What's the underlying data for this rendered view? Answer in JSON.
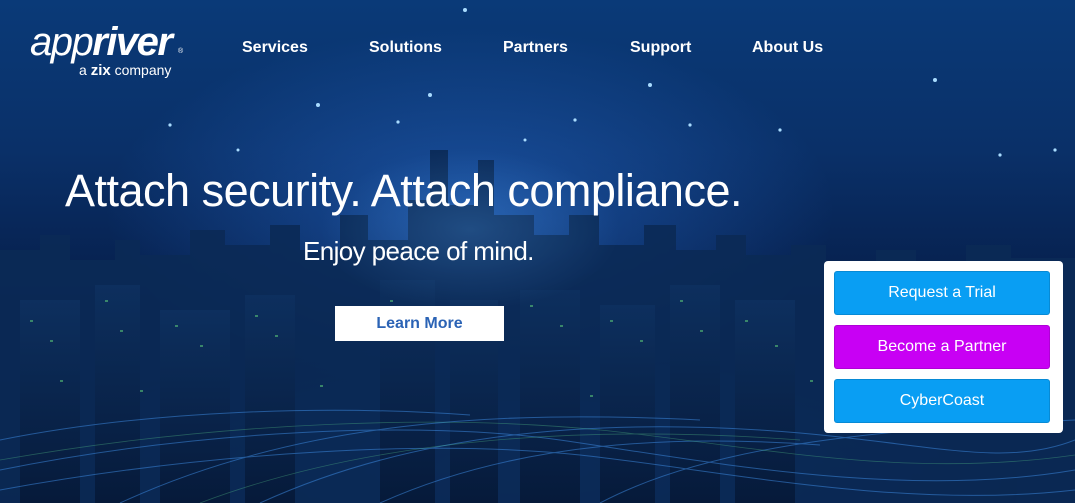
{
  "logo": {
    "word_light": "app",
    "word_bold": "river",
    "registered": "®",
    "tag_prefix": "a ",
    "tag_brand": "zix",
    "tag_suffix": " company"
  },
  "nav": {
    "items": [
      {
        "label": "Services"
      },
      {
        "label": "Solutions"
      },
      {
        "label": "Partners"
      },
      {
        "label": "Support"
      },
      {
        "label": "About Us"
      }
    ]
  },
  "hero": {
    "headline": "Attach security. Attach compliance.",
    "subheadline": "Enjoy peace of mind.",
    "cta_label": "Learn More"
  },
  "cta_panel": {
    "buttons": [
      {
        "label": "Request a Trial",
        "color": "#099ef3"
      },
      {
        "label": "Become a Partner",
        "color": "#c800f4"
      },
      {
        "label": "CyberCoast",
        "color": "#099ef3"
      }
    ]
  },
  "colors": {
    "learn_more_text": "#2b63b5",
    "background_dark": "#04183a",
    "background_light": "#0a3a78"
  }
}
